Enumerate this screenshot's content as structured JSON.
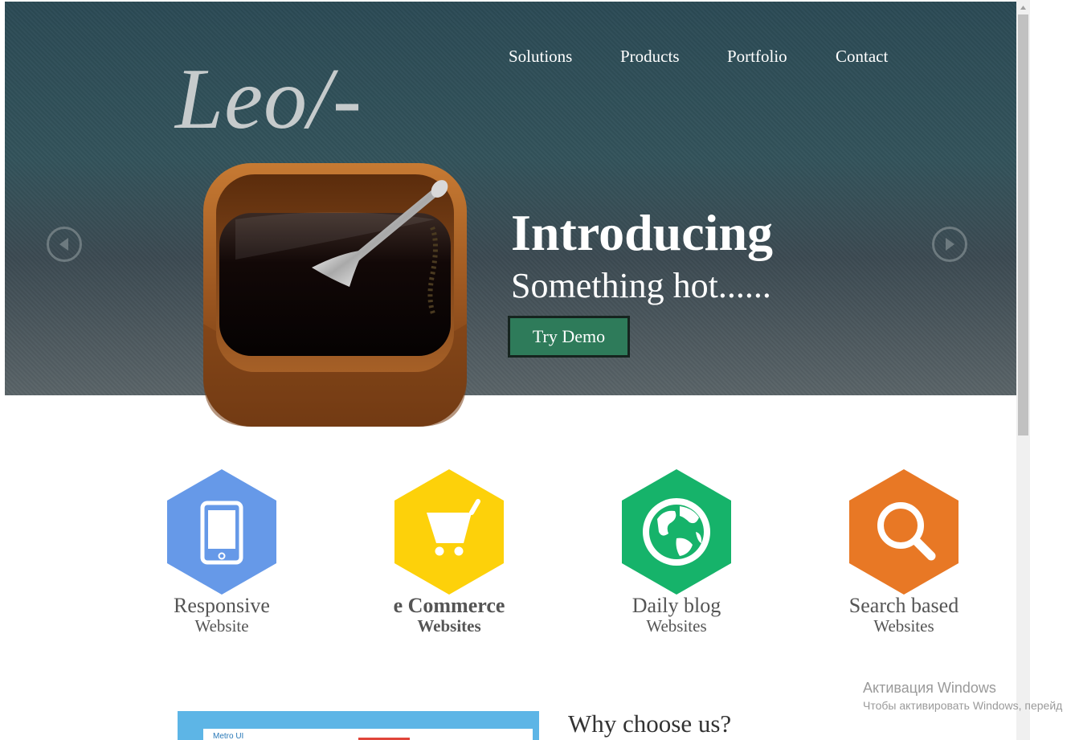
{
  "brand": {
    "logo": "Leo/-"
  },
  "nav": {
    "items": [
      "Solutions",
      "Products",
      "Portfolio",
      "Contact"
    ]
  },
  "hero": {
    "title": "Introducing",
    "subtitle": "Something hot......",
    "cta_label": "Try Demo"
  },
  "features": [
    {
      "title": "Responsive",
      "subtitle": "Website",
      "color": "#6699e8",
      "icon": "tablet-icon"
    },
    {
      "title": "e Commerce",
      "subtitle": "Websites",
      "color": "#fdd10a",
      "icon": "cart-icon"
    },
    {
      "title": "Daily blog",
      "subtitle": "Websites",
      "color": "#16b36a",
      "icon": "globe-icon"
    },
    {
      "title": "Search based",
      "subtitle": "Websites",
      "color": "#e87825",
      "icon": "search-icon"
    }
  ],
  "section": {
    "why_title": "Why choose us?"
  },
  "preview": {
    "label": "Metro UI"
  },
  "watermark": {
    "line1": "Активация Windows",
    "line2": "Чтобы активировать Windows, перейд"
  }
}
